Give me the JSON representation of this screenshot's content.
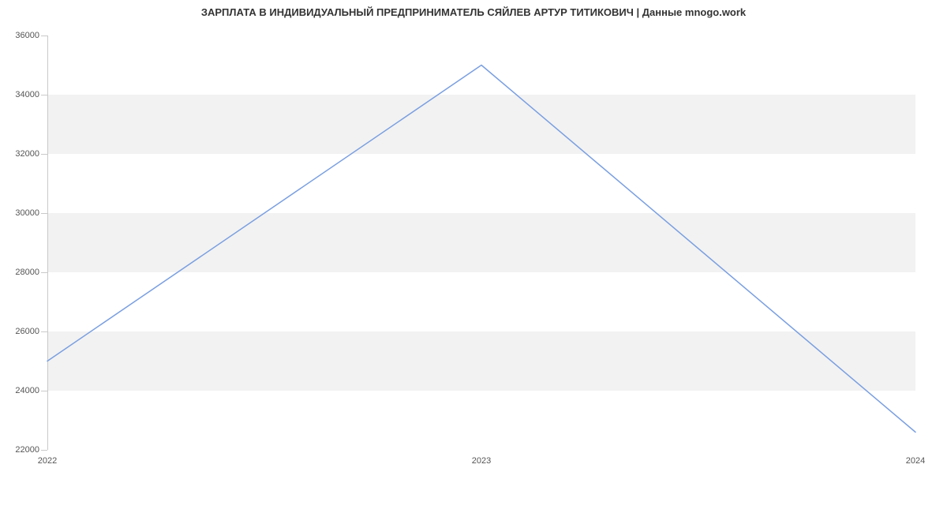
{
  "chart_data": {
    "type": "line",
    "title": "ЗАРПЛАТА В ИНДИВИДУАЛЬНЫЙ ПРЕДПРИНИМАТЕЛЬ СЯЙЛЕВ АРТУР ТИТИКОВИЧ | Данные mnogo.work",
    "x": [
      "2022",
      "2023",
      "2024"
    ],
    "values": [
      25000,
      35000,
      22600
    ],
    "xlabel": "",
    "ylabel": "",
    "ylim": [
      22000,
      36000
    ],
    "y_ticks": [
      22000,
      24000,
      26000,
      28000,
      30000,
      32000,
      34000,
      36000
    ],
    "x_ticks": [
      "2022",
      "2023",
      "2024"
    ],
    "line_color": "#7a9fe0",
    "band_color": "#f2f2f2"
  }
}
